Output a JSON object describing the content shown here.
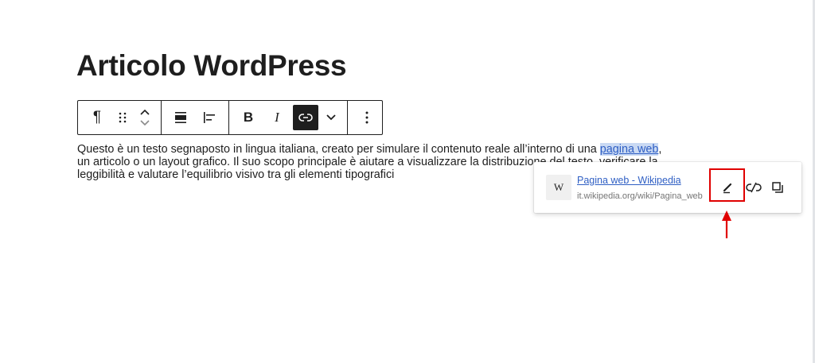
{
  "post": {
    "title": "Articolo WordPress"
  },
  "toolbar": {
    "groups": [
      [
        {
          "name": "paragraph-icon",
          "glyph": "¶"
        },
        {
          "name": "drag-handle-icon"
        },
        {
          "name": "move-up-icon"
        },
        {
          "name": "move-down-icon"
        }
      ],
      [
        {
          "name": "align-wide-icon"
        },
        {
          "name": "align-left-icon"
        }
      ],
      [
        {
          "name": "bold-button",
          "glyph": "B"
        },
        {
          "name": "italic-button",
          "glyph": "I"
        },
        {
          "name": "link-button",
          "state": "active"
        },
        {
          "name": "more-formatting-chevron-icon"
        }
      ],
      [
        {
          "name": "options-menu-icon"
        }
      ]
    ]
  },
  "paragraph": {
    "line1_before": "Questo è un testo segnaposto in lingua italiana, creato per simulare il contenuto reale all’interno di una ",
    "link_text": "pagina web",
    "line1_after": ",",
    "line2": "un articolo o un layout grafico. Il suo scopo principale è aiutare a visualizzare la distribuzione del testo, verificare la",
    "line3": "leggibilità e valutare l’equilibrio visivo tra gli elementi tipografici"
  },
  "link_popover": {
    "favicon_glyph": "W",
    "title": "Pagina web - Wikipedia",
    "url": "it.wikipedia.org/wiki/Pagina_web",
    "actions": [
      "edit-link-icon",
      "unlink-icon",
      "copy-link-icon"
    ]
  },
  "annotation": {
    "highlight_color": "#e00000",
    "highlighted_action": "edit-link-icon"
  },
  "colors": {
    "text": "#1e1e1e",
    "link": "#2f5fc4",
    "selection": "#c9d9f3",
    "annotation": "#e00000"
  }
}
